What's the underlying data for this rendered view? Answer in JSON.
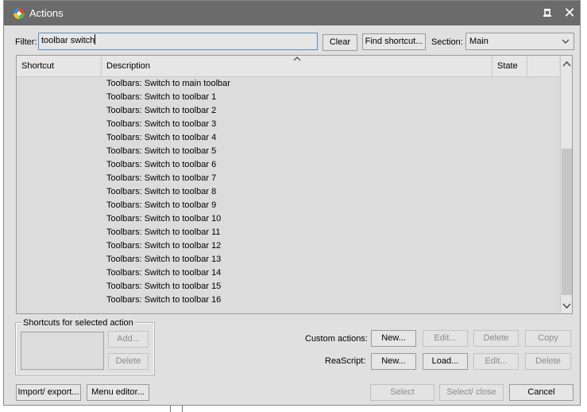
{
  "window": {
    "title": "Actions",
    "pin_icon": "pin-icon",
    "close_icon": "close-icon"
  },
  "filter": {
    "label": "Filter:",
    "value": "toolbar switch"
  },
  "buttons": {
    "clear": "Clear",
    "find_shortcut": "Find shortcut..."
  },
  "section": {
    "label": "Section:",
    "value": "Main"
  },
  "table": {
    "columns": [
      "Shortcut",
      "Description",
      "State"
    ],
    "rows": [
      "Toolbars: Switch to main toolbar",
      "Toolbars: Switch to toolbar 1",
      "Toolbars: Switch to toolbar 2",
      "Toolbars: Switch to toolbar 3",
      "Toolbars: Switch to toolbar 4",
      "Toolbars: Switch to toolbar 5",
      "Toolbars: Switch to toolbar 6",
      "Toolbars: Switch to toolbar 7",
      "Toolbars: Switch to toolbar 8",
      "Toolbars: Switch to toolbar 9",
      "Toolbars: Switch to toolbar 10",
      "Toolbars: Switch to toolbar 11",
      "Toolbars: Switch to toolbar 12",
      "Toolbars: Switch to toolbar 13",
      "Toolbars: Switch to toolbar 14",
      "Toolbars: Switch to toolbar 15",
      "Toolbars: Switch to toolbar 16"
    ]
  },
  "shortcuts_group": {
    "title": "Shortcuts for selected action",
    "add": "Add...",
    "delete": "Delete"
  },
  "custom_actions": {
    "label": "Custom actions:",
    "new": "New...",
    "edit": "Edit...",
    "delete": "Delete",
    "copy": "Copy"
  },
  "reascript": {
    "label": "ReaScript:",
    "new": "New...",
    "load": "Load...",
    "edit": "Edit...",
    "delete": "Delete"
  },
  "bottom": {
    "import_export": "Import/ export...",
    "menu_editor": "Menu editor...",
    "select": "Select",
    "select_close": "Select/ close",
    "cancel": "Cancel"
  },
  "colors": {
    "titlebar": "#6b6b6b",
    "dialog": "#e0e0e0",
    "list_bg": "#dcdcdc",
    "focus_border": "#5a8fbf"
  }
}
